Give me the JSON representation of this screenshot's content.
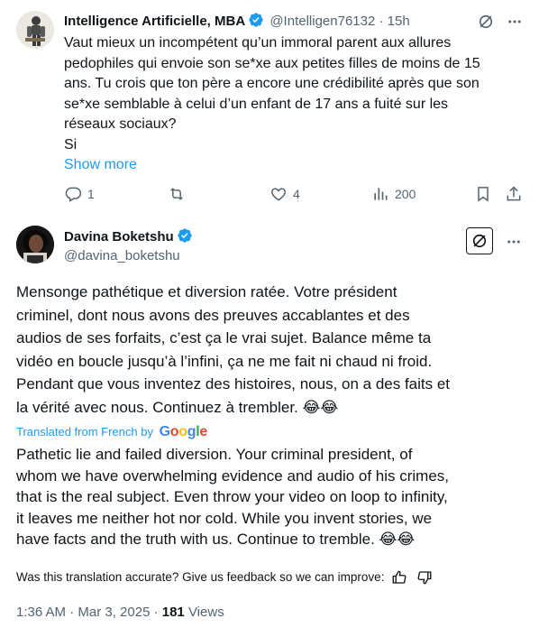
{
  "reply": {
    "author_name": "Intelligence Artificielle, MBA",
    "handle": "@Intelligen76132",
    "separator": "·",
    "time": "15h",
    "text_lines": [
      "Vaut mieux un incompétent qu’un immoral parent aux allures",
      "pedophiles qui envoie son se*xe aux petites filles de moins de 15",
      "ans. Tu crois que ton père a encore une crédibilité après que son",
      "se*xe semblable à celui d’un enfant de 17 ans a fuité sur les",
      "réseaux sociaux?",
      "Si"
    ],
    "show_more": "Show more",
    "actions": {
      "replies": "1",
      "likes": "4",
      "views": "200"
    }
  },
  "main_tweet": {
    "author_name": "Davina Boketshu",
    "handle": "@davina_boketshu",
    "original_lines": [
      "Mensonge pathétique et diversion ratée. Votre président",
      "criminel, dont nous avons des preuves accablantes et des",
      "audios de ses forfaits, c’est ça le vrai sujet. Balance même ta",
      "vidéo en boucle jusqu’à l’infini, ça ne me fait ni chaud ni froid.",
      "Pendant que vous inventez des histoires, nous, on a des faits et",
      "la vérité avec nous. Continuez à trembler. 😂😂"
    ],
    "translated_from": "Translated from French by",
    "google": {
      "G": "G",
      "o1": "o",
      "o2": "o",
      "g": "g",
      "l": "l",
      "e": "e"
    },
    "translation_lines": [
      "Pathetic lie and failed diversion. Your criminal president, of",
      "whom we have overwhelming evidence and audio of his crimes,",
      "that is the real subject. Even throw your video on loop to infinity,",
      "it leaves me neither hot nor cold. While you invent stories, we",
      "have facts and the truth with us. Continue to tremble. 😂😂"
    ],
    "feedback_prompt": "Was this translation accurate? Give us feedback so we can improve:",
    "timestamp": "1:36 AM · Mar 3, 2025 ·",
    "views_count": "181",
    "views_label": "Views"
  },
  "colors": {
    "text": "#0f1419",
    "muted": "#536471",
    "link": "#1d9bf0",
    "verified": "#1d9bf0",
    "google_blue": "#4285f4",
    "google_red": "#ea4335",
    "google_yellow": "#fbbc05",
    "google_green": "#34a853"
  }
}
